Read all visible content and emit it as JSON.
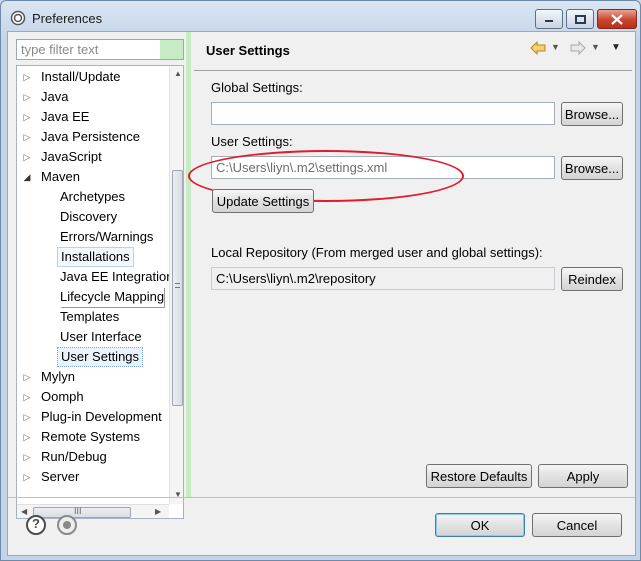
{
  "window": {
    "title": "Preferences"
  },
  "filter": {
    "placeholder": "type filter text"
  },
  "tree": {
    "items": [
      {
        "label": "Install/Update",
        "expandable": true
      },
      {
        "label": "Java",
        "expandable": true
      },
      {
        "label": "Java EE",
        "expandable": true
      },
      {
        "label": "Java Persistence",
        "expandable": true
      },
      {
        "label": "JavaScript",
        "expandable": true
      },
      {
        "label": "Maven",
        "expanded": true
      },
      {
        "label": "Archetypes"
      },
      {
        "label": "Discovery"
      },
      {
        "label": "Errors/Warnings"
      },
      {
        "label": "Installations"
      },
      {
        "label": "Java EE Integration"
      },
      {
        "label": "Lifecycle Mapping"
      },
      {
        "label": "Templates"
      },
      {
        "label": "User Interface"
      },
      {
        "label": "User Settings",
        "selected": true
      },
      {
        "label": "Mylyn",
        "expandable": true
      },
      {
        "label": "Oomph",
        "expandable": true
      },
      {
        "label": "Plug-in Development",
        "expandable": true
      },
      {
        "label": "Remote Systems",
        "expandable": true
      },
      {
        "label": "Run/Debug",
        "expandable": true
      },
      {
        "label": "Server",
        "expandable": true
      }
    ],
    "hscroll_grip": "III"
  },
  "page": {
    "title": "User Settings",
    "global_settings_label": "Global Settings:",
    "global_settings_value": "",
    "user_settings_label": "User Settings:",
    "user_settings_value": "C:\\Users\\liyn\\.m2\\settings.xml",
    "browse_label": "Browse...",
    "update_settings_label": "Update Settings",
    "local_repo_label": "Local Repository (From merged user and global settings):",
    "local_repo_value": "C:\\Users\\liyn\\.m2\\repository",
    "reindex_label": "Reindex",
    "restore_defaults_label": "Restore Defaults",
    "apply_label": "Apply"
  },
  "footer": {
    "ok_label": "OK",
    "cancel_label": "Cancel"
  },
  "colors": {
    "annotation": "#e01b2b",
    "filter_highlight": "#c7ecc3",
    "nav_back": "#e0a020"
  }
}
